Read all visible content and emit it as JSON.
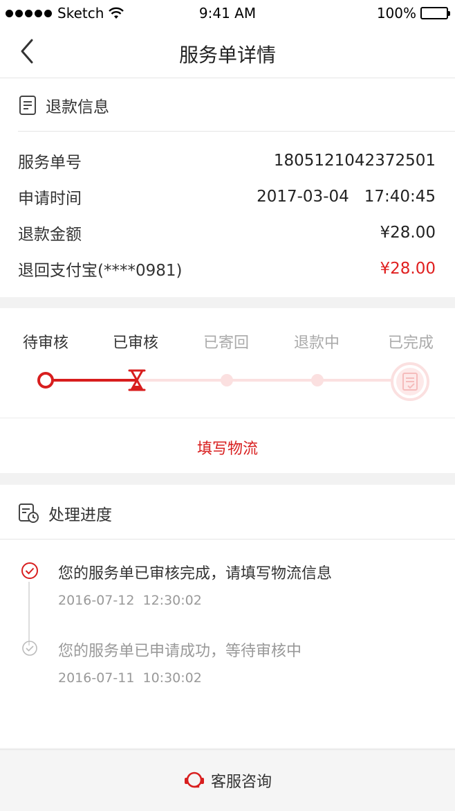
{
  "status_bar": {
    "carrier": "Sketch",
    "time": "9:41 AM",
    "battery": "100%"
  },
  "nav": {
    "title": "服务单详情",
    "back_icon": "chevron-left-icon"
  },
  "refund_info": {
    "header": "退款信息",
    "rows": [
      {
        "key": "服务单号",
        "value": "1805121042372501"
      },
      {
        "key": "申请时间",
        "value": "2017-03-04   17:40:45"
      },
      {
        "key": "退款金额",
        "value": "¥28.00"
      },
      {
        "key": "退回支付宝(****0981)",
        "value": "¥28.00"
      }
    ]
  },
  "progress": {
    "steps": [
      "待审核",
      "已审核",
      "已寄回",
      "退款中",
      "已完成"
    ],
    "current_step": 2,
    "link": "填写物流"
  },
  "process": {
    "header": "处理进度",
    "items": [
      {
        "text": "您的服务单已审核完成，请填写物流信息",
        "time": "2016-07-12  12:30:02"
      },
      {
        "text": "您的服务单已申请成功，等待审核中",
        "time": "2016-07-11  10:30:02"
      }
    ]
  },
  "footer": {
    "label": "客服咨询"
  },
  "colors": {
    "accent": "#d81e1e",
    "light_accent": "#fbe3e3",
    "red_value": "#e02020"
  }
}
